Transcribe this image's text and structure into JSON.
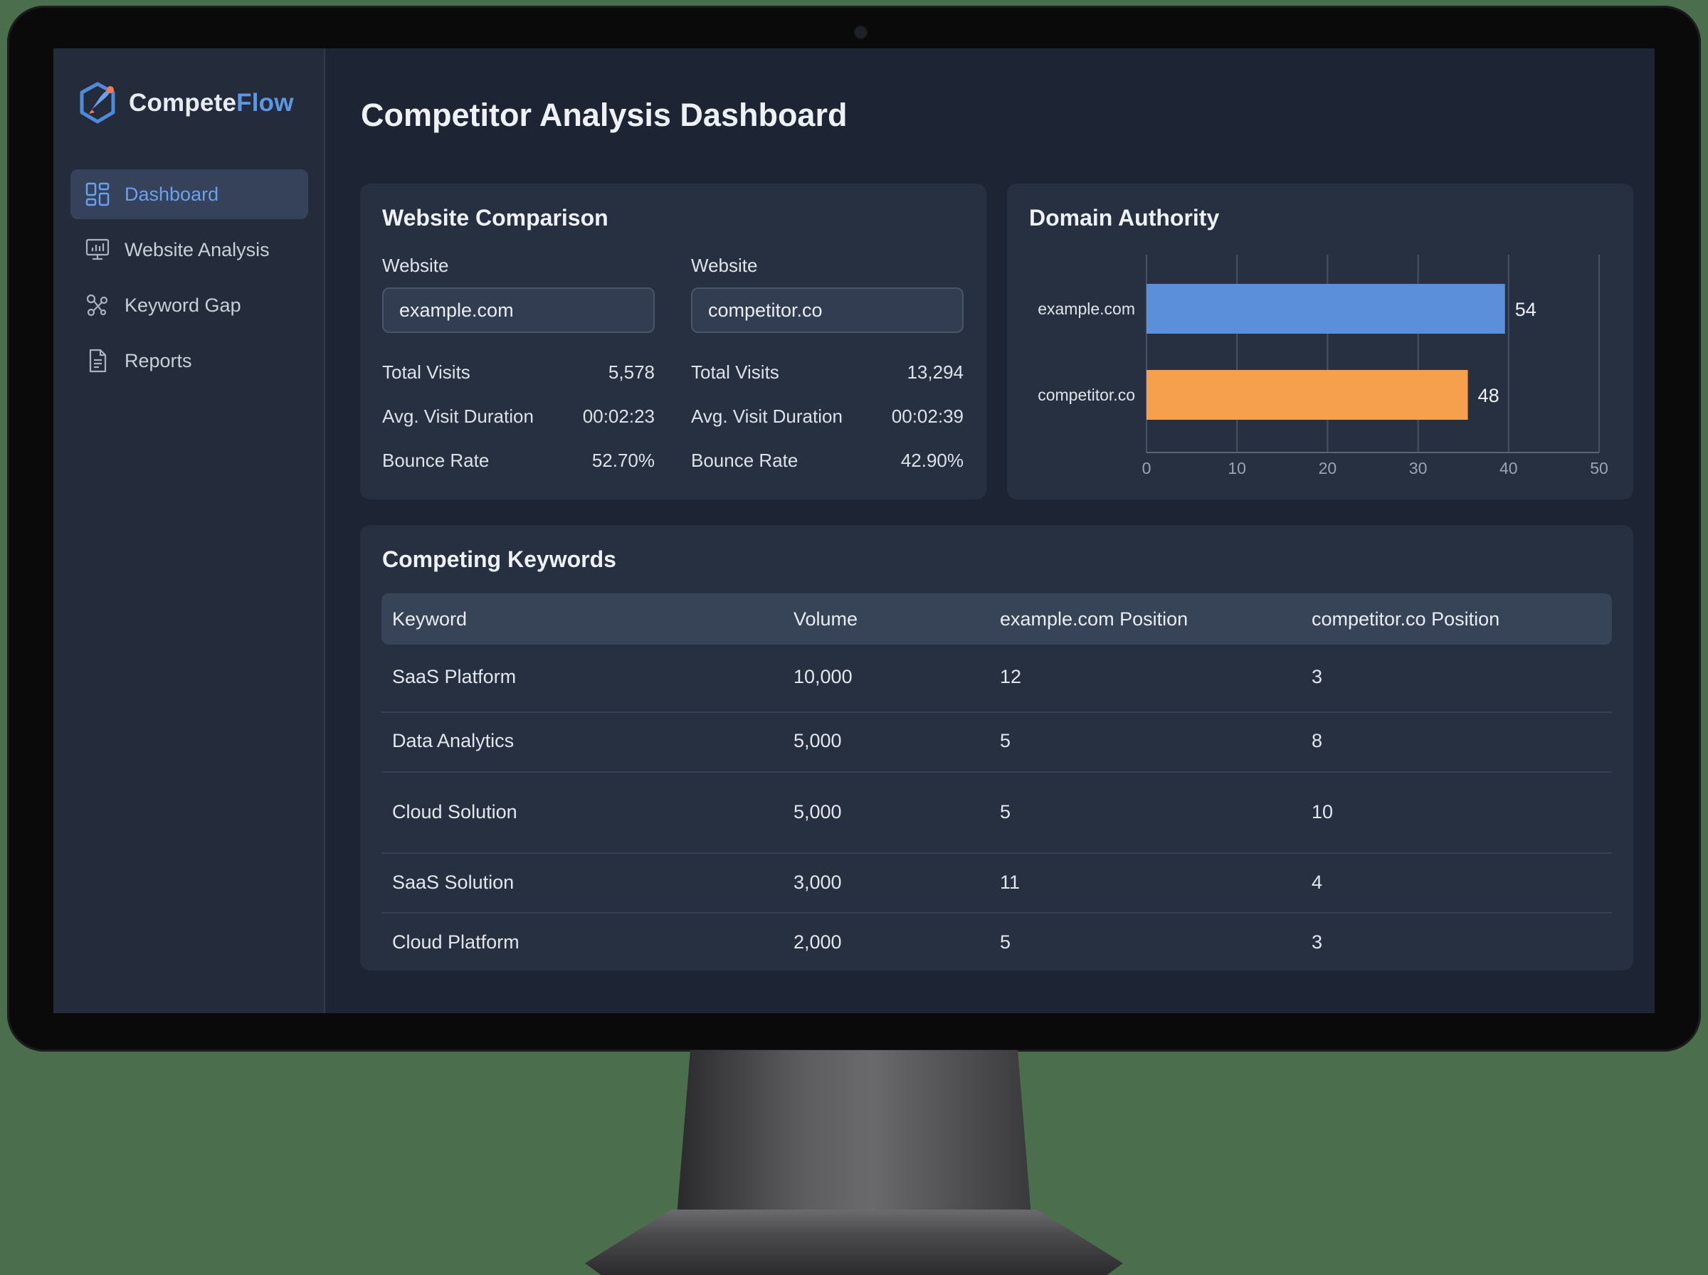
{
  "app": {
    "name_part1": "Compete",
    "name_part2": "Flow"
  },
  "sidebar": {
    "items": [
      {
        "label": "Dashboard",
        "icon": "dashboard-grid-icon",
        "active": true
      },
      {
        "label": "Website Analysis",
        "icon": "monitor-chart-icon",
        "active": false
      },
      {
        "label": "Keyword Gap",
        "icon": "nodes-icon",
        "active": false
      },
      {
        "label": "Reports",
        "icon": "document-icon",
        "active": false
      }
    ]
  },
  "page": {
    "title": "Competitor Analysis Dashboard"
  },
  "comparison": {
    "title": "Website Comparison",
    "sites": [
      {
        "label": "Website",
        "value": "example.com",
        "stats": [
          {
            "label": "Total Visits",
            "value": "5,578"
          },
          {
            "label": "Avg. Visit Duration",
            "value": "00:02:23"
          },
          {
            "label": "Bounce Rate",
            "value": "52.70%"
          }
        ]
      },
      {
        "label": "Website",
        "value": "competitor.co",
        "stats": [
          {
            "label": "Total Visits",
            "value": "13,294"
          },
          {
            "label": "Avg. Visit Duration",
            "value": "00:02:39"
          },
          {
            "label": "Bounce Rate",
            "value": "42.90%"
          }
        ]
      }
    ]
  },
  "domain_authority": {
    "title": "Domain Authority"
  },
  "chart_data": {
    "type": "bar",
    "orientation": "horizontal",
    "title": "Domain Authority",
    "categories": [
      "example.com",
      "competitor.co"
    ],
    "values": [
      54,
      48
    ],
    "colors": [
      "#5b8fd9",
      "#f6a04d"
    ],
    "xlim": [
      0,
      50
    ],
    "xticks": [
      0,
      10,
      20,
      30,
      40,
      50
    ],
    "grid": true,
    "note_bar_extent": [
      39.6,
      35.5
    ]
  },
  "keywords": {
    "title": "Competing Keywords",
    "columns": [
      "Keyword",
      "Volume",
      "example.com Position",
      "competitor.co Position"
    ],
    "rows": [
      [
        "SaaS Platform",
        "10,000",
        "12",
        "3"
      ],
      [
        "Data Analytics",
        "5,000",
        "5",
        "8"
      ],
      [
        "Cloud Solution",
        "5,000",
        "5",
        "10"
      ],
      [
        "SaaS Solution",
        "3,000",
        "11",
        "4"
      ],
      [
        "Cloud Platform",
        "2,000",
        "5",
        "3"
      ]
    ]
  },
  "colors": {
    "accent": "#5c97e6",
    "bar_primary": "#5b8fd9",
    "bar_secondary": "#f6a04d",
    "background": "#1d2433",
    "card": "#273041"
  }
}
